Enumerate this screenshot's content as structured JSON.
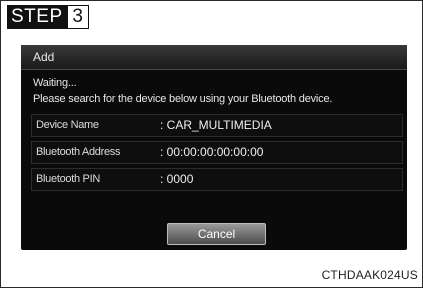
{
  "step": {
    "label": "STEP",
    "number": "3"
  },
  "dialog": {
    "title": "Add",
    "status": "Waiting...",
    "instruction": "Please search for the device below using your Bluetooth device.",
    "rows": [
      {
        "label": "Device Name",
        "value": ": CAR_MULTIMEDIA"
      },
      {
        "label": "Bluetooth Address",
        "value": ": 00:00:00:00:00:00"
      },
      {
        "label": "Bluetooth PIN",
        "value": ": 0000"
      }
    ],
    "cancel_label": "Cancel"
  },
  "caption": "CTHDAAK024US"
}
